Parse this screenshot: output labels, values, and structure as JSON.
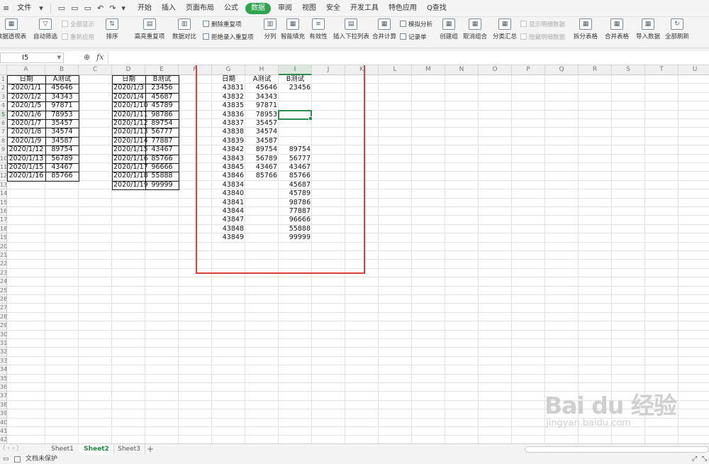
{
  "menubar": {
    "file": "文件",
    "quick_access": [
      "▾",
      "▭",
      "▭",
      "▭",
      "↶",
      "↷",
      "▾"
    ],
    "tabs": [
      {
        "label": "开始",
        "active": false
      },
      {
        "label": "插入",
        "active": false
      },
      {
        "label": "页面布局",
        "active": false
      },
      {
        "label": "公式",
        "active": false
      },
      {
        "label": "数据",
        "active": true
      },
      {
        "label": "审阅",
        "active": false
      },
      {
        "label": "视图",
        "active": false
      },
      {
        "label": "安全",
        "active": false
      },
      {
        "label": "开发工具",
        "active": false
      },
      {
        "label": "特色应用",
        "active": false
      }
    ],
    "search": "Q查找"
  },
  "ribbon": {
    "big_buttons": [
      {
        "label": "数据透视表",
        "icon": "▦"
      },
      {
        "label": "自动筛选",
        "icon": "▽"
      },
      {
        "label": "排序",
        "icon": "⇅"
      },
      {
        "label": "高亮重复项",
        "icon": "▤"
      },
      {
        "label": "数据对比",
        "icon": "▥"
      },
      {
        "label": "分列",
        "icon": "▥"
      },
      {
        "label": "智能填充",
        "icon": "▦"
      },
      {
        "label": "有效性",
        "icon": "≡"
      },
      {
        "label": "插入下拉列表",
        "icon": "▤"
      },
      {
        "label": "合并计算",
        "icon": "▦"
      },
      {
        "label": "创建组",
        "icon": "▦"
      },
      {
        "label": "取消组合",
        "icon": "▦"
      },
      {
        "label": "分类汇总",
        "icon": "▦"
      },
      {
        "label": "拆分表格",
        "icon": "▦"
      },
      {
        "label": "合并表格",
        "icon": "▦"
      },
      {
        "label": "导入数据",
        "icon": "▦"
      },
      {
        "label": "全部刷新",
        "icon": "↻"
      }
    ],
    "small_buttons": [
      {
        "label": "全部显示",
        "dim": true
      },
      {
        "label": "重新应用",
        "dim": true
      },
      {
        "label": "删除重复项",
        "dim": false
      },
      {
        "label": "拒绝录入重复项",
        "dim": false
      },
      {
        "label": "模拟分析",
        "dim": false
      },
      {
        "label": "记录单",
        "dim": false
      },
      {
        "label": "显示明细数据",
        "dim": true
      },
      {
        "label": "隐藏明细数据",
        "dim": true
      }
    ]
  },
  "formula_bar": {
    "name_box": "I5",
    "zoom_icon": "⊕",
    "fx": "fx",
    "value": ""
  },
  "columns": [
    "A",
    "B",
    "C",
    "D",
    "E",
    "F",
    "G",
    "H",
    "I",
    "J",
    "K",
    "L",
    "M",
    "N",
    "O",
    "P",
    "Q",
    "R",
    "S",
    "T",
    "U"
  ],
  "rows": [
    "1",
    "2",
    "3",
    "4",
    "5",
    "6",
    "7",
    "8",
    "9",
    "10",
    "11",
    "12",
    "13",
    "14",
    "15",
    "16",
    "17",
    "18",
    "19",
    "20",
    "21",
    "22",
    "23",
    "24",
    "25",
    "26",
    "27",
    "28",
    "29",
    "30",
    "31",
    "32",
    "33",
    "34",
    "35",
    "36",
    "37",
    "38",
    "39",
    "40",
    "41",
    "42"
  ],
  "table_left": {
    "headers": [
      "日期",
      "A测试"
    ],
    "rows": [
      [
        "2020/1/1",
        "45646"
      ],
      [
        "2020/1/2",
        "34343"
      ],
      [
        "2020/1/5",
        "97871"
      ],
      [
        "2020/1/6",
        "78953"
      ],
      [
        "2020/1/7",
        "35457"
      ],
      [
        "2020/1/8",
        "34574"
      ],
      [
        "2020/1/9",
        "34587"
      ],
      [
        "2020/1/12",
        "89754"
      ],
      [
        "2020/1/13",
        "56789"
      ],
      [
        "2020/1/15",
        "43467"
      ],
      [
        "2020/1/16",
        "85766"
      ]
    ]
  },
  "table_middle": {
    "headers": [
      "日期",
      "B测试"
    ],
    "rows": [
      [
        "2020/1/3",
        "23456"
      ],
      [
        "2020/1/4",
        "45687"
      ],
      [
        "2020/1/10",
        "45789"
      ],
      [
        "2020/1/11",
        "98786"
      ],
      [
        "2020/1/12",
        "89754"
      ],
      [
        "2020/1/13",
        "56777"
      ],
      [
        "2020/1/14",
        "77887"
      ],
      [
        "2020/1/15",
        "43467"
      ],
      [
        "2020/1/16",
        "85766"
      ],
      [
        "2020/1/17",
        "96666"
      ],
      [
        "2020/1/18",
        "55888"
      ],
      [
        "2020/1/19",
        "99999"
      ]
    ]
  },
  "table_result": {
    "headers": [
      "日期",
      "A测试",
      "B测试"
    ],
    "rows": [
      [
        "43831",
        "45646",
        "23456"
      ],
      [
        "43832",
        "34343",
        ""
      ],
      [
        "43835",
        "97871",
        ""
      ],
      [
        "43836",
        "78953",
        ""
      ],
      [
        "43837",
        "35457",
        ""
      ],
      [
        "43838",
        "34574",
        ""
      ],
      [
        "43839",
        "34587",
        ""
      ],
      [
        "43842",
        "89754",
        "89754"
      ],
      [
        "43843",
        "56789",
        "56777"
      ],
      [
        "43845",
        "43467",
        "43467"
      ],
      [
        "43846",
        "85766",
        "85766"
      ],
      [
        "43834",
        "",
        "45687"
      ],
      [
        "43840",
        "",
        "45789"
      ],
      [
        "43841",
        "",
        "98786"
      ],
      [
        "43844",
        "",
        "77887"
      ],
      [
        "43847",
        "",
        "96666"
      ],
      [
        "43848",
        "",
        "55888"
      ],
      [
        "43849",
        "",
        "99999"
      ]
    ]
  },
  "sheet_tabs": [
    {
      "label": "Sheet1",
      "active": false
    },
    {
      "label": "Sheet2",
      "active": true
    },
    {
      "label": "Sheet3",
      "active": false
    },
    {
      "label": "+",
      "active": false
    }
  ],
  "status": {
    "protect": "文档未保护"
  },
  "watermark": {
    "text": "Bai du 经验",
    "url": "jingyan.baidu.com"
  },
  "colors": {
    "accent": "#2ea44f",
    "highlight_box": "#d9403a",
    "selection": "#2e8b4e"
  }
}
